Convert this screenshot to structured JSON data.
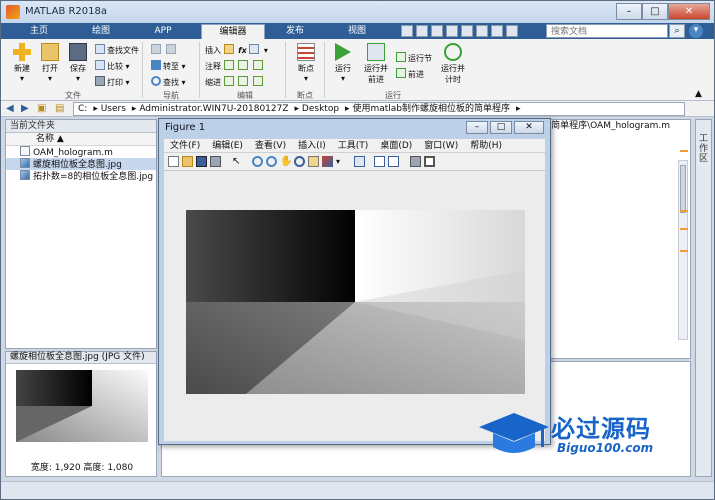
{
  "app": {
    "title": "MATLAB R2018a"
  },
  "tabs": [
    {
      "label": "主页"
    },
    {
      "label": "绘图"
    },
    {
      "label": "APP"
    },
    {
      "label": "编辑器"
    },
    {
      "label": "发布"
    },
    {
      "label": "视图"
    }
  ],
  "search": {
    "placeholder": "搜索文档"
  },
  "ribbon": {
    "file": {
      "group_label": "文件",
      "new": "新建",
      "open": "打开",
      "save": "保存",
      "find_files": "查找文件",
      "compare": "比较",
      "print": "打印"
    },
    "navigate": {
      "group_label": "导航",
      "goto": "转至",
      "find": "查找"
    },
    "edit": {
      "group_label": "编辑",
      "insert": "插入",
      "comment": "注释",
      "indent": "缩进",
      "fx": "fx"
    },
    "breakpoints": {
      "group_label": "断点",
      "label": "断点"
    },
    "run": {
      "group_label": "运行",
      "run": "运行",
      "run_advance": "运行并\n前进",
      "run_section": "运行节",
      "advance": "前进",
      "run_time": "运行并\n计时"
    }
  },
  "address": {
    "segments": [
      "C:",
      "Users",
      "Administrator.WIN7U-20180127Z",
      "Desktop",
      "使用matlab制作螺旋相位板的简单程序"
    ]
  },
  "left_pane": {
    "title": "当前文件夹",
    "column_name": "名称 ▲",
    "files": [
      {
        "name": "OAM_hologram.m",
        "type": "m",
        "selected": false
      },
      {
        "name": "螺旋相位板全息图.jpg",
        "type": "img",
        "selected": true
      },
      {
        "name": "拓扑数=8的相位板全息图.jpg",
        "type": "img",
        "selected": false
      }
    ]
  },
  "preview": {
    "title": "螺旋相位板全息图.jpg  (JPG 文件)",
    "info": "宽度: 1,920 高度: 1,080"
  },
  "editor": {
    "tab_label": "简单程序\\OAM_hologram.m"
  },
  "workspace": {
    "label": "工作区"
  },
  "figure": {
    "title": "Figure 1",
    "menu": [
      "文件(F)",
      "编辑(E)",
      "查看(V)",
      "插入(I)",
      "工具(T)",
      "桌面(D)",
      "窗口(W)",
      "帮助(H)"
    ]
  },
  "watermark": {
    "text": "必过源码",
    "sub": "Biguo100.com"
  }
}
